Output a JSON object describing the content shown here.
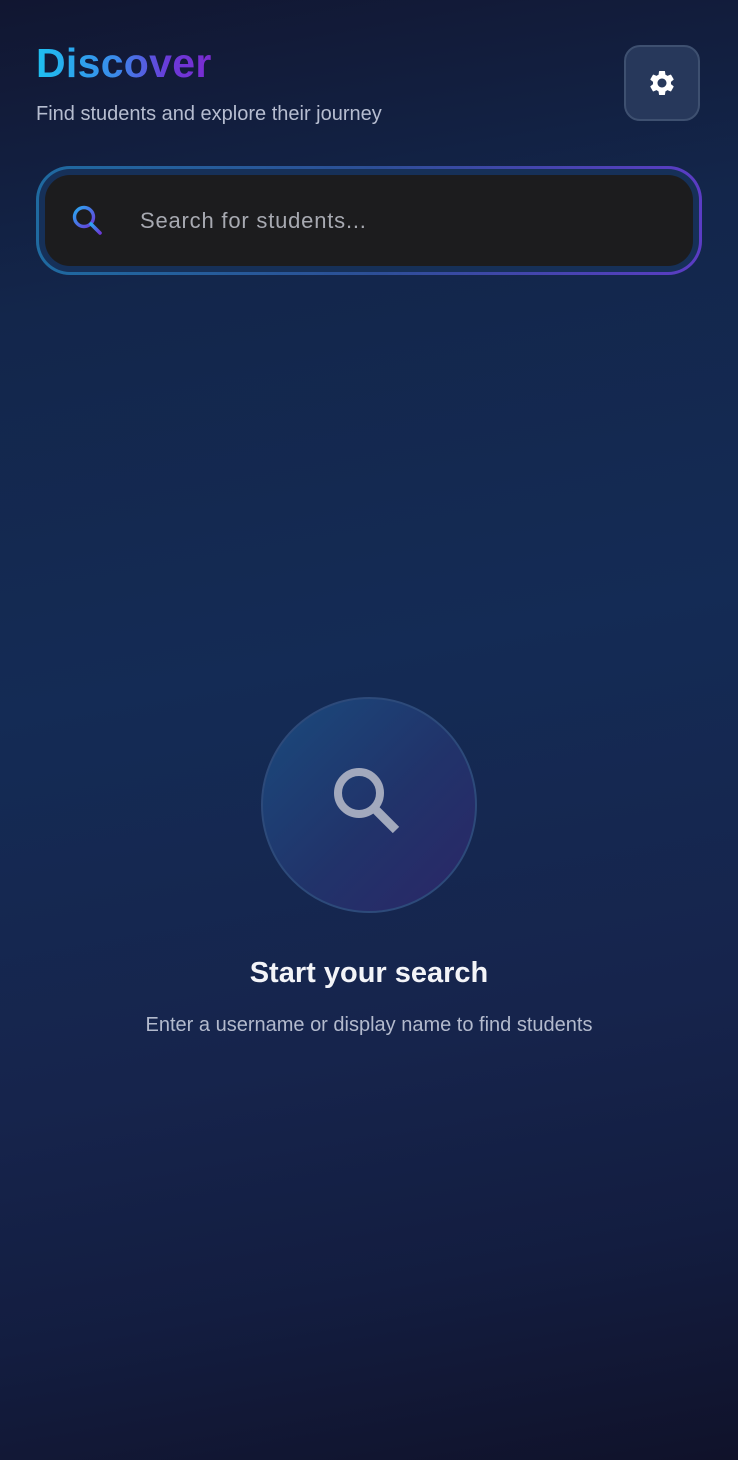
{
  "header": {
    "title": "Discover",
    "subtitle": "Find students and explore their journey"
  },
  "settings": {
    "icon": "gear-icon"
  },
  "search": {
    "placeholder": "Search for students...",
    "value": "",
    "icon": "search-icon"
  },
  "empty_state": {
    "icon": "magnifier-icon",
    "title": "Start your search",
    "subtitle": "Enter a username or display name to find students"
  },
  "colors": {
    "title_gradient_start": "#1ec0f0",
    "title_gradient_end": "#7b2bd0",
    "background": "#142b55",
    "search_field": "#1c1c1e"
  }
}
